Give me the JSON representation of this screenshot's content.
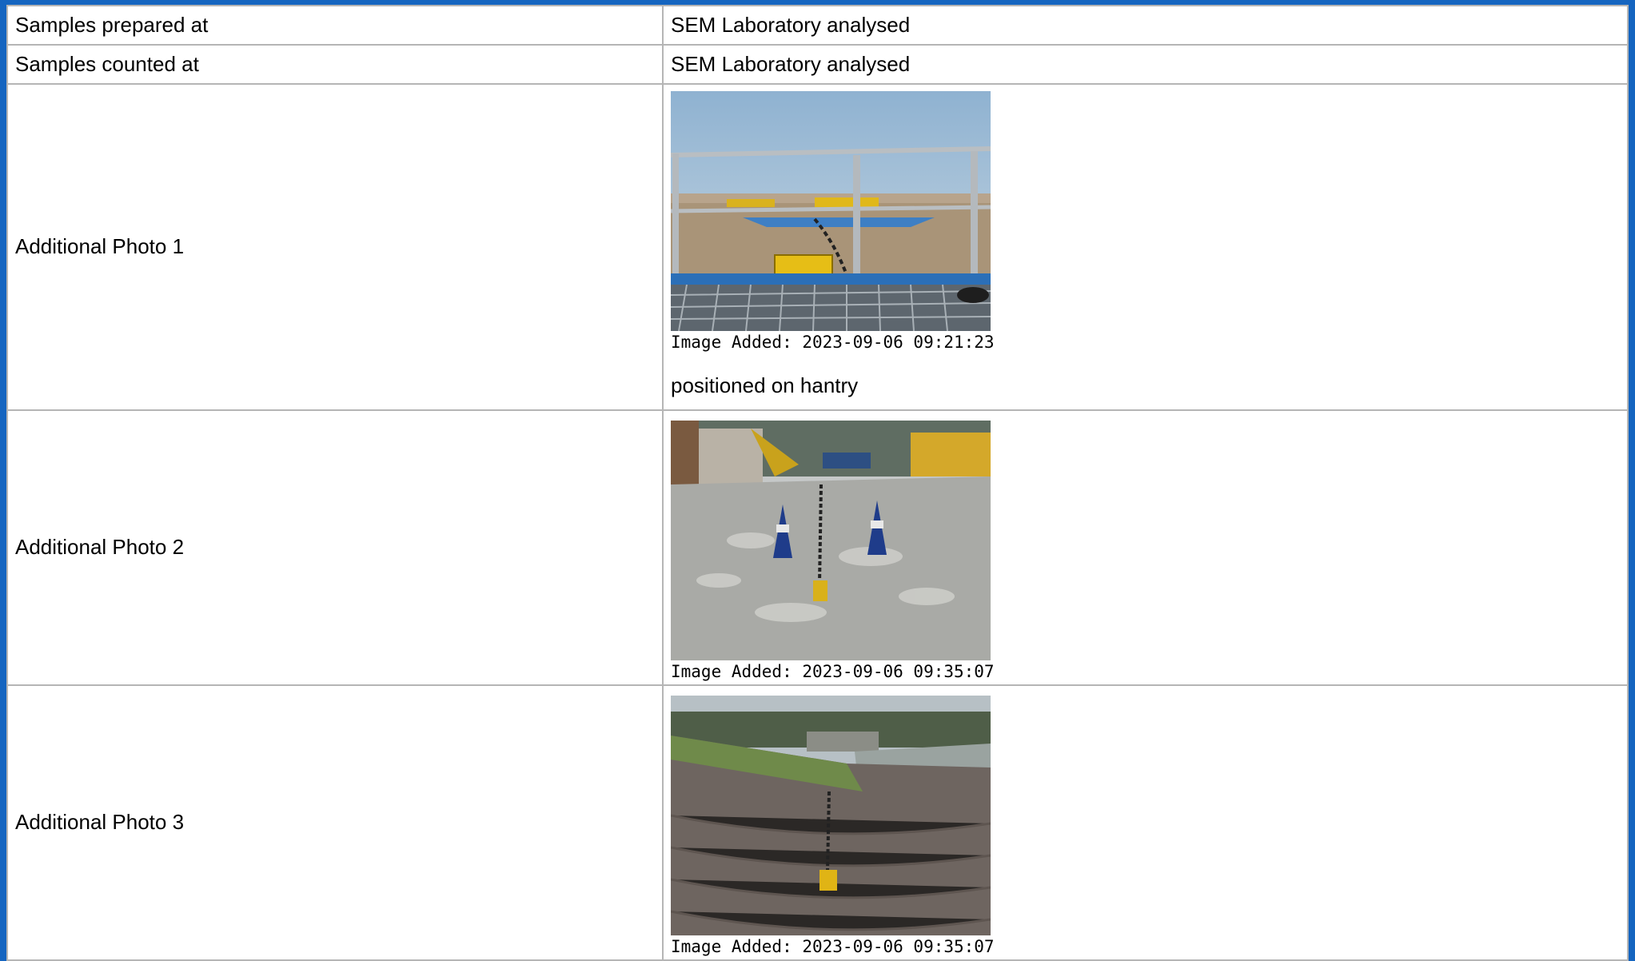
{
  "rows": [
    {
      "label": "Samples prepared at",
      "value": "SEM Laboratory analysed"
    },
    {
      "label": "Samples counted at",
      "value": "SEM Laboratory analysed"
    }
  ],
  "photos": [
    {
      "label": "Additional Photo 1",
      "caption": "Image Added: 2023-09-06 09:21:23",
      "note": "positioned on hantry"
    },
    {
      "label": "Additional Photo 2",
      "caption": "Image Added: 2023-09-06 09:35:07"
    },
    {
      "label": "Additional Photo 3",
      "caption": "Image Added: 2023-09-06 09:35:07"
    }
  ],
  "colors": {
    "frame": "#1565c0",
    "grid": "#b5b5b5"
  }
}
